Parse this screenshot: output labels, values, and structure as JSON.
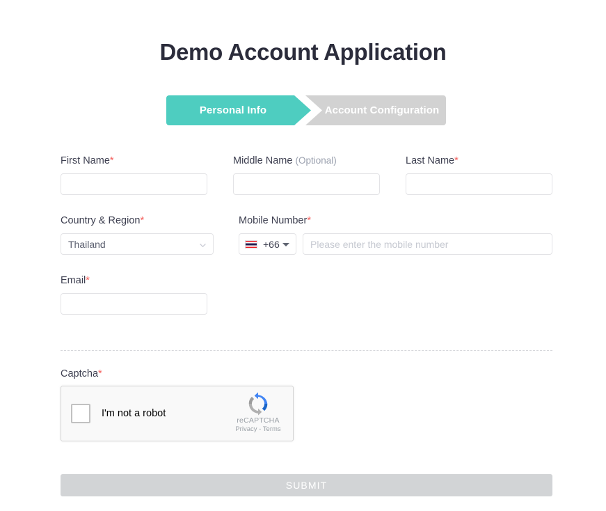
{
  "page": {
    "title": "Demo Account Application"
  },
  "stepper": {
    "steps": [
      {
        "label": "Personal Info",
        "state": "active",
        "color": "#4ecdc0"
      },
      {
        "label": "Account Configuration",
        "state": "inactive",
        "color": "#d2d2d2"
      }
    ]
  },
  "form": {
    "required_marker": "*",
    "fields": {
      "first_name": {
        "label": "First Name",
        "required": true,
        "value": "",
        "placeholder": ""
      },
      "middle_name": {
        "label": "Middle Name",
        "required": false,
        "optional_text": "(Optional)",
        "value": "",
        "placeholder": ""
      },
      "last_name": {
        "label": "Last Name",
        "required": true,
        "value": "",
        "placeholder": ""
      },
      "country_region": {
        "label": "Country & Region",
        "required": true,
        "selected": "Thailand",
        "options": [
          "Thailand"
        ]
      },
      "mobile_number": {
        "label": "Mobile Number",
        "required": true,
        "country_code": "+66",
        "flag": "thailand-flag",
        "value": "",
        "placeholder": "Please enter the mobile number"
      },
      "email": {
        "label": "Email",
        "required": true,
        "value": "",
        "placeholder": ""
      }
    }
  },
  "captcha": {
    "label": "Captcha",
    "required": true,
    "widget": {
      "checkbox_label": "I'm not a robot",
      "brand": "reCAPTCHA",
      "privacy": "Privacy",
      "separator": "-",
      "terms": "Terms",
      "checked": false
    }
  },
  "submit": {
    "label": "SUBMIT",
    "disabled": true,
    "color": "#d2d4d6"
  },
  "colors": {
    "accent": "#4ecdc0",
    "inactive": "#d2d2d2",
    "required": "#f4615e",
    "title": "#2b2c3b",
    "label": "#3d3f50",
    "border": "#e3e3e6"
  }
}
